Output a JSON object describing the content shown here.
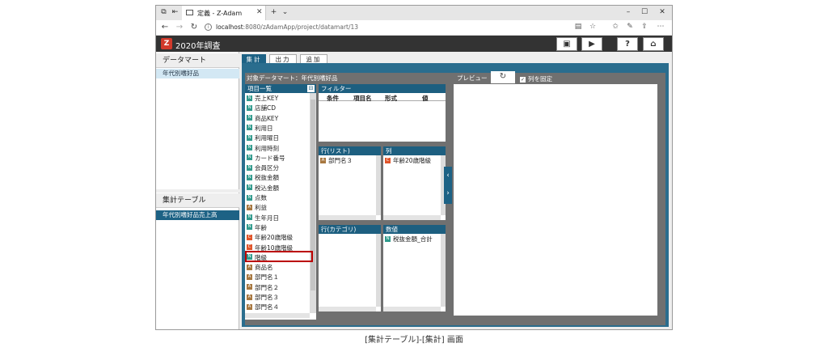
{
  "browser": {
    "tab_title": "定義 - Z-Adam",
    "url_host": "localhost",
    "url_rest": ":8080/zAdamApp/project/datamart/13"
  },
  "app": {
    "title": "2020年調査",
    "logo": "Z"
  },
  "left": {
    "datamart_header": "データマート",
    "datamart_items": [
      "年代別嗜好品"
    ],
    "table_header": "集計テーブル",
    "table_items": [
      "年代別嗜好品売上高"
    ]
  },
  "tabs": [
    "集計",
    "出力",
    "追加"
  ],
  "target": "対象データマート：年代別嗜好品",
  "items_header": "項目一覧",
  "items": [
    {
      "badge": "N",
      "type": "n",
      "label": "売上KEY"
    },
    {
      "badge": "N",
      "type": "n",
      "label": "店舗CD"
    },
    {
      "badge": "N",
      "type": "n",
      "label": "商品KEY"
    },
    {
      "badge": "N",
      "type": "n",
      "label": "利用日"
    },
    {
      "badge": "N",
      "type": "n",
      "label": "利用曜日"
    },
    {
      "badge": "N",
      "type": "n",
      "label": "利用時刻"
    },
    {
      "badge": "N",
      "type": "n",
      "label": "カード番号"
    },
    {
      "badge": "N",
      "type": "n",
      "label": "会員区分"
    },
    {
      "badge": "N",
      "type": "n",
      "label": "税抜金額"
    },
    {
      "badge": "N",
      "type": "n",
      "label": "税込金額"
    },
    {
      "badge": "N",
      "type": "n",
      "label": "点数"
    },
    {
      "badge": "A",
      "type": "a",
      "label": "利益"
    },
    {
      "badge": "N",
      "type": "n",
      "label": "生年月日"
    },
    {
      "badge": "N",
      "type": "n",
      "label": "年齢"
    },
    {
      "badge": "C",
      "type": "c",
      "label": "年齢20歳階級"
    },
    {
      "badge": "C",
      "type": "c",
      "label": "年齢10歳階級"
    },
    {
      "badge": "N",
      "type": "n",
      "label": "階級"
    },
    {
      "badge": "A",
      "type": "a",
      "label": "商品名"
    },
    {
      "badge": "A",
      "type": "a",
      "label": "部門名１"
    },
    {
      "badge": "A",
      "type": "a",
      "label": "部門名２"
    },
    {
      "badge": "A",
      "type": "a",
      "label": "部門名３"
    },
    {
      "badge": "A",
      "type": "a",
      "label": "部門名４"
    }
  ],
  "filter": {
    "header": "フィルター",
    "columns": [
      "条件",
      "項目名",
      "形式",
      "値"
    ]
  },
  "rows_list": {
    "header": "行(リスト)",
    "items": [
      {
        "badge": "A",
        "type": "a",
        "label": "部門名３"
      }
    ]
  },
  "cols": {
    "header": "列",
    "items": [
      {
        "badge": "C",
        "type": "c",
        "label": "年齢20歳階級"
      }
    ]
  },
  "rows_cat": {
    "header": "行(カテゴリ)",
    "items": []
  },
  "values": {
    "header": "数値",
    "items": [
      {
        "badge": "N",
        "type": "n",
        "label": "税抜金額_合計"
      }
    ]
  },
  "preview": {
    "label": "プレビュー",
    "fix_cols": "列を固定"
  },
  "caption": "[集計テーブル]-[集計] 画面"
}
